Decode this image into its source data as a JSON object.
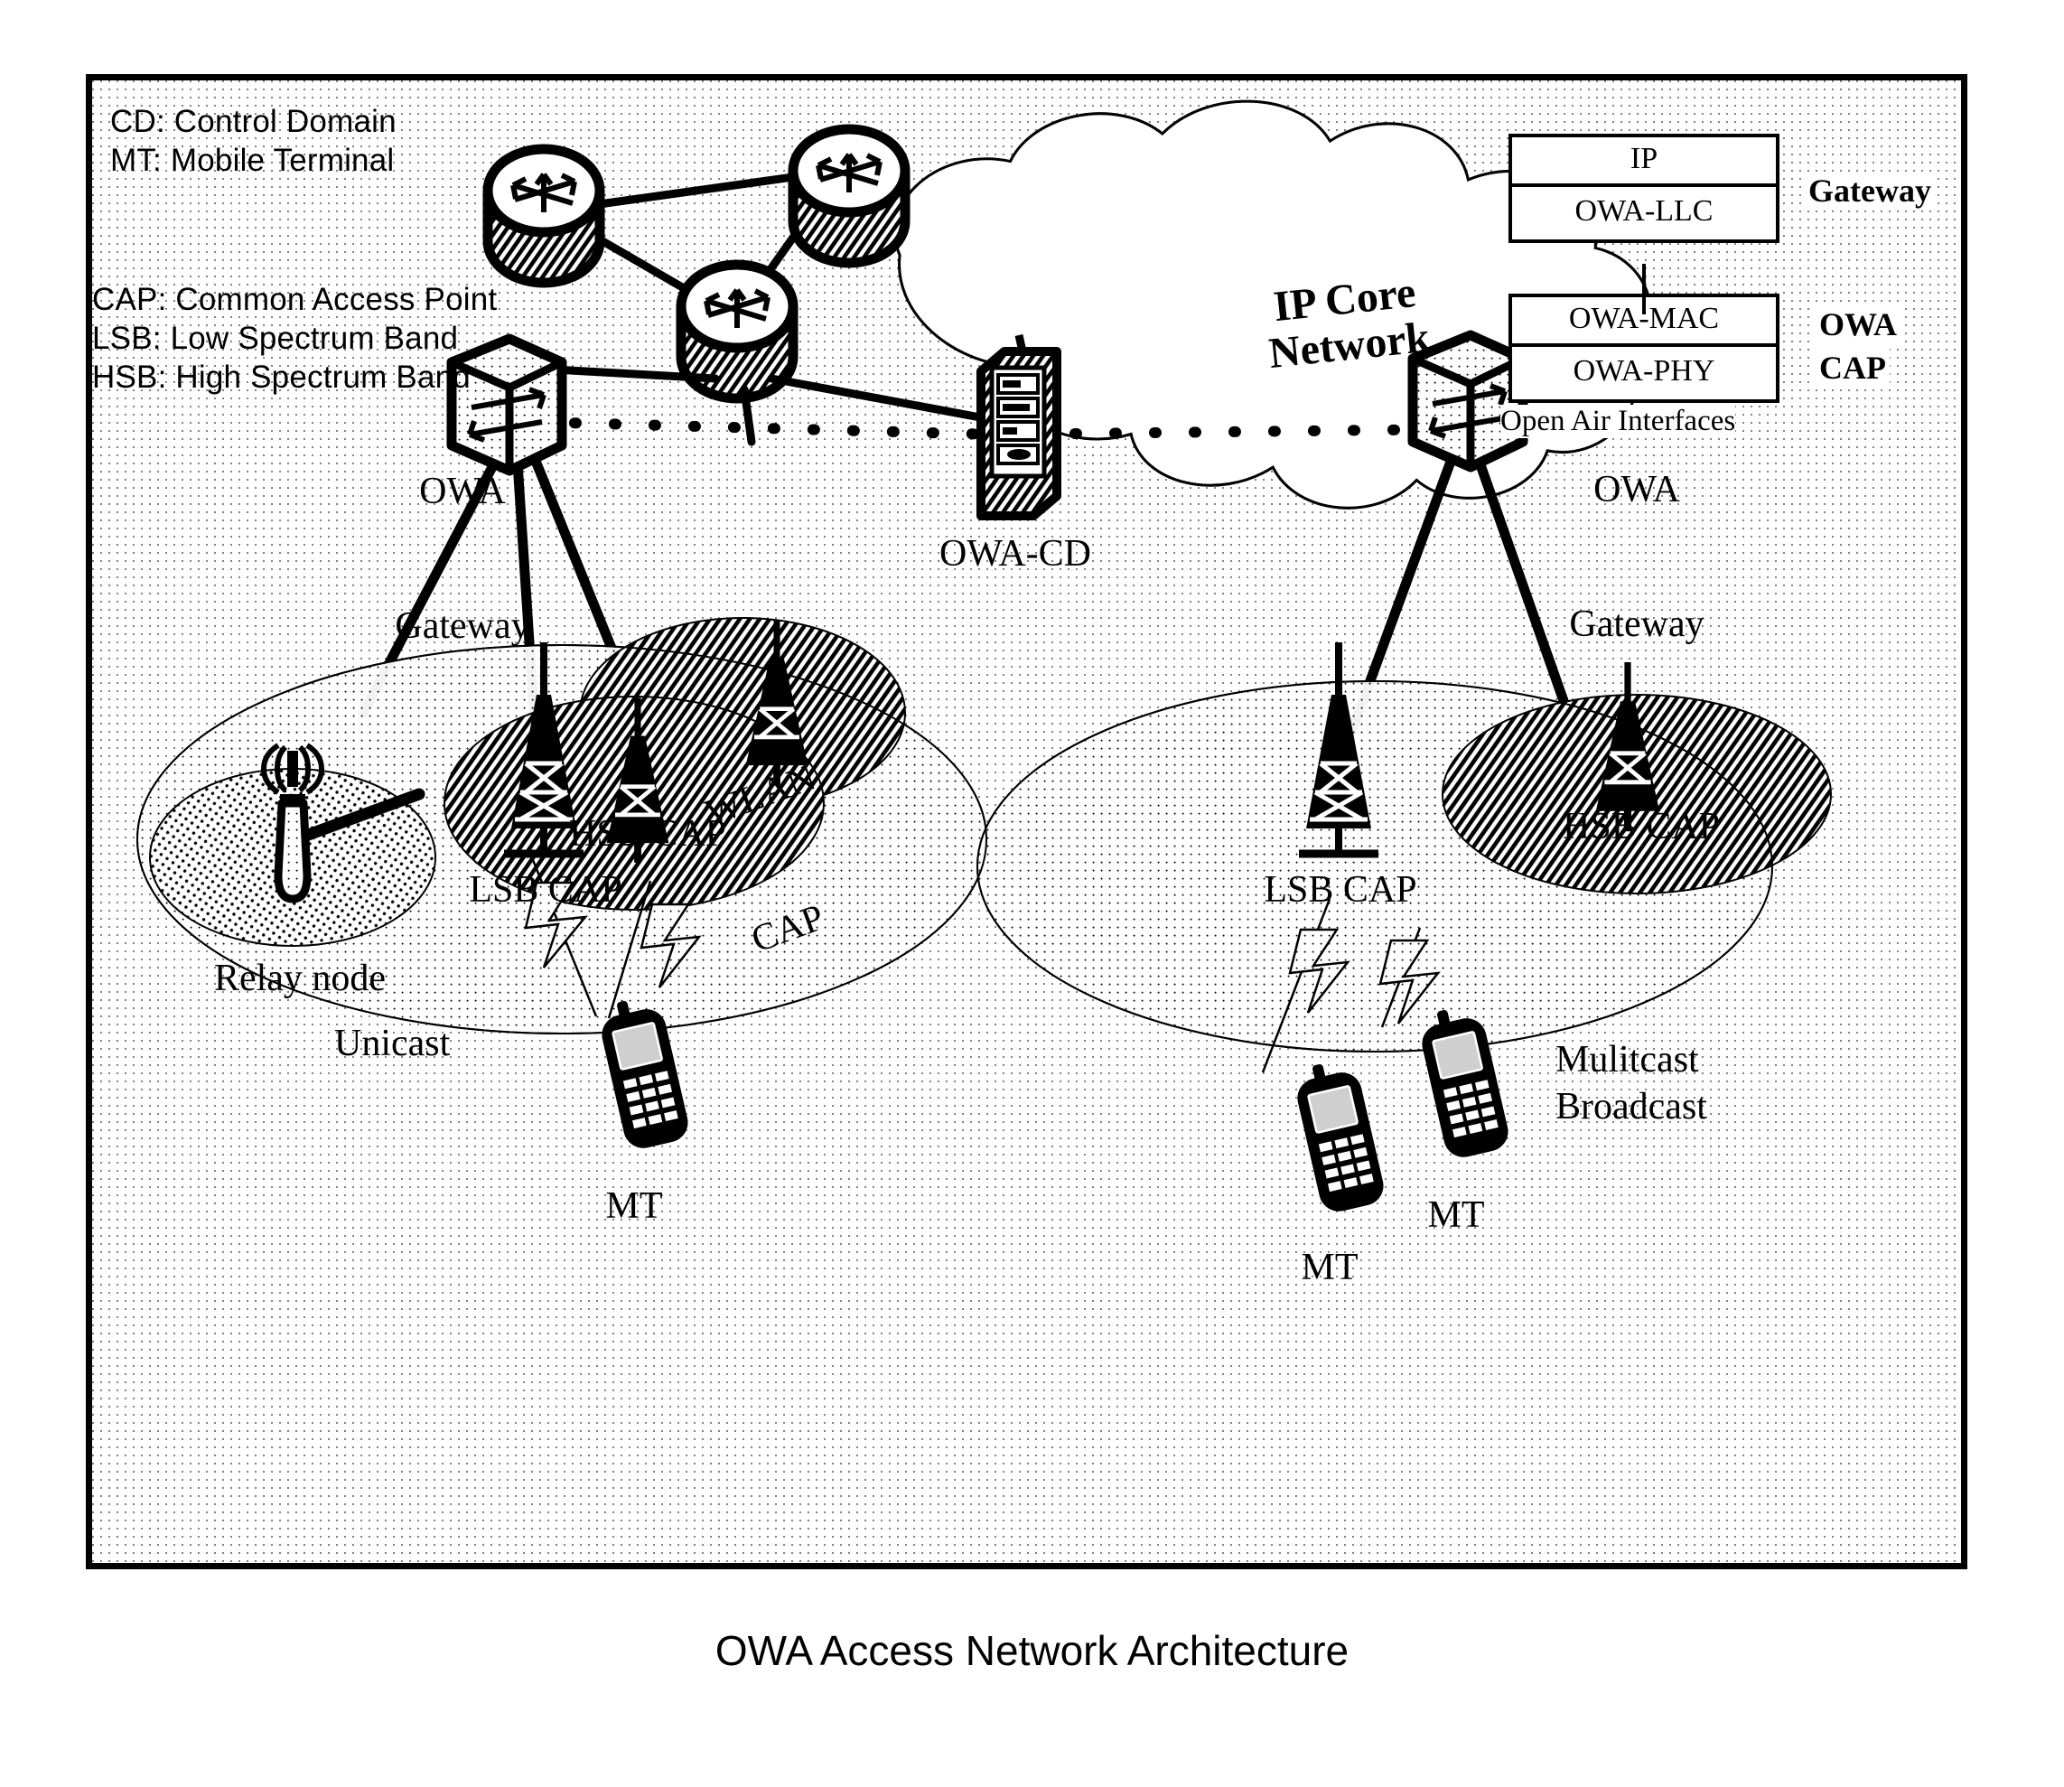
{
  "figure": {
    "caption": "OWA Access Network Architecture"
  },
  "legend": {
    "group1": [
      "CD: Control Domain",
      "MT: Mobile Terminal"
    ],
    "group2": [
      "CAP: Common Access Point",
      "LSB: Low Spectrum Band",
      "HSB: High Spectrum Band"
    ]
  },
  "protocol_stack": {
    "upper_layers": [
      "IP",
      "OWA-LLC"
    ],
    "lower_layers": [
      "OWA-MAC",
      "OWA-PHY"
    ],
    "upper_label": "Gateway",
    "lower_label_line1": "OWA",
    "lower_label_line2": "CAP",
    "footnote": "Open Air Interfaces"
  },
  "core": {
    "cloud_label_line1": "IP Core",
    "cloud_label_line2": "Network",
    "router_count": 3
  },
  "nodes": {
    "gateway_left_line1": "OWA",
    "gateway_left_line2": "Gateway",
    "gateway_right_line1": "OWA",
    "gateway_right_line2": "Gateway",
    "control_domain": "OWA-CD",
    "relay": "Relay node",
    "lsb_cap_left": "LSB CAP",
    "lsb_cap_right": "LSB CAP",
    "wlan_cap_line1": "WLAN",
    "wlan_cap_line2": "CAP",
    "hsb_cap_left": "HSB CAP",
    "hsb_cap_right": "HSB CAP"
  },
  "terminals": {
    "mt_left": "MT",
    "mt_right_a": "MT",
    "mt_right_b": "MT"
  },
  "traffic": {
    "unicast": "Unicast",
    "multicast": "Mulitcast",
    "broadcast": "Broadcast"
  },
  "colors": {
    "ink": "#000000",
    "paper": "#ffffff"
  }
}
